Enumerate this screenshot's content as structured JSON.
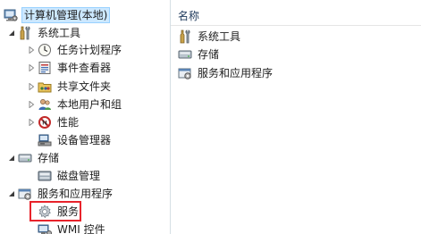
{
  "tree": {
    "root": {
      "label": "计算机管理(本地)",
      "icon": "computer-management-icon"
    },
    "system_tools": {
      "label": "系统工具",
      "icon": "tools-icon",
      "children": [
        {
          "label": "任务计划程序",
          "icon": "clock-icon"
        },
        {
          "label": "事件查看器",
          "icon": "event-viewer-icon"
        },
        {
          "label": "共享文件夹",
          "icon": "shared-folder-icon"
        },
        {
          "label": "本地用户和组",
          "icon": "users-icon"
        },
        {
          "label": "性能",
          "icon": "no-sign-icon"
        },
        {
          "label": "设备管理器",
          "icon": "device-manager-icon"
        }
      ]
    },
    "storage": {
      "label": "存储",
      "icon": "storage-icon",
      "children": [
        {
          "label": "磁盘管理",
          "icon": "disk-icon"
        }
      ]
    },
    "services_apps": {
      "label": "服务和应用程序",
      "icon": "services-apps-icon",
      "children": [
        {
          "label": "服务",
          "icon": "gear-icon",
          "highlighted": true
        },
        {
          "label": "WMI 控件",
          "icon": "wmi-icon"
        }
      ]
    }
  },
  "list": {
    "column_header": "名称",
    "items": [
      {
        "label": "系统工具",
        "icon": "tools-icon"
      },
      {
        "label": "存储",
        "icon": "storage-icon"
      },
      {
        "label": "服务和应用程序",
        "icon": "services-apps-icon"
      }
    ]
  },
  "colors": {
    "selection_bg": "#cce8ff",
    "highlight_box": "#e8232b"
  }
}
